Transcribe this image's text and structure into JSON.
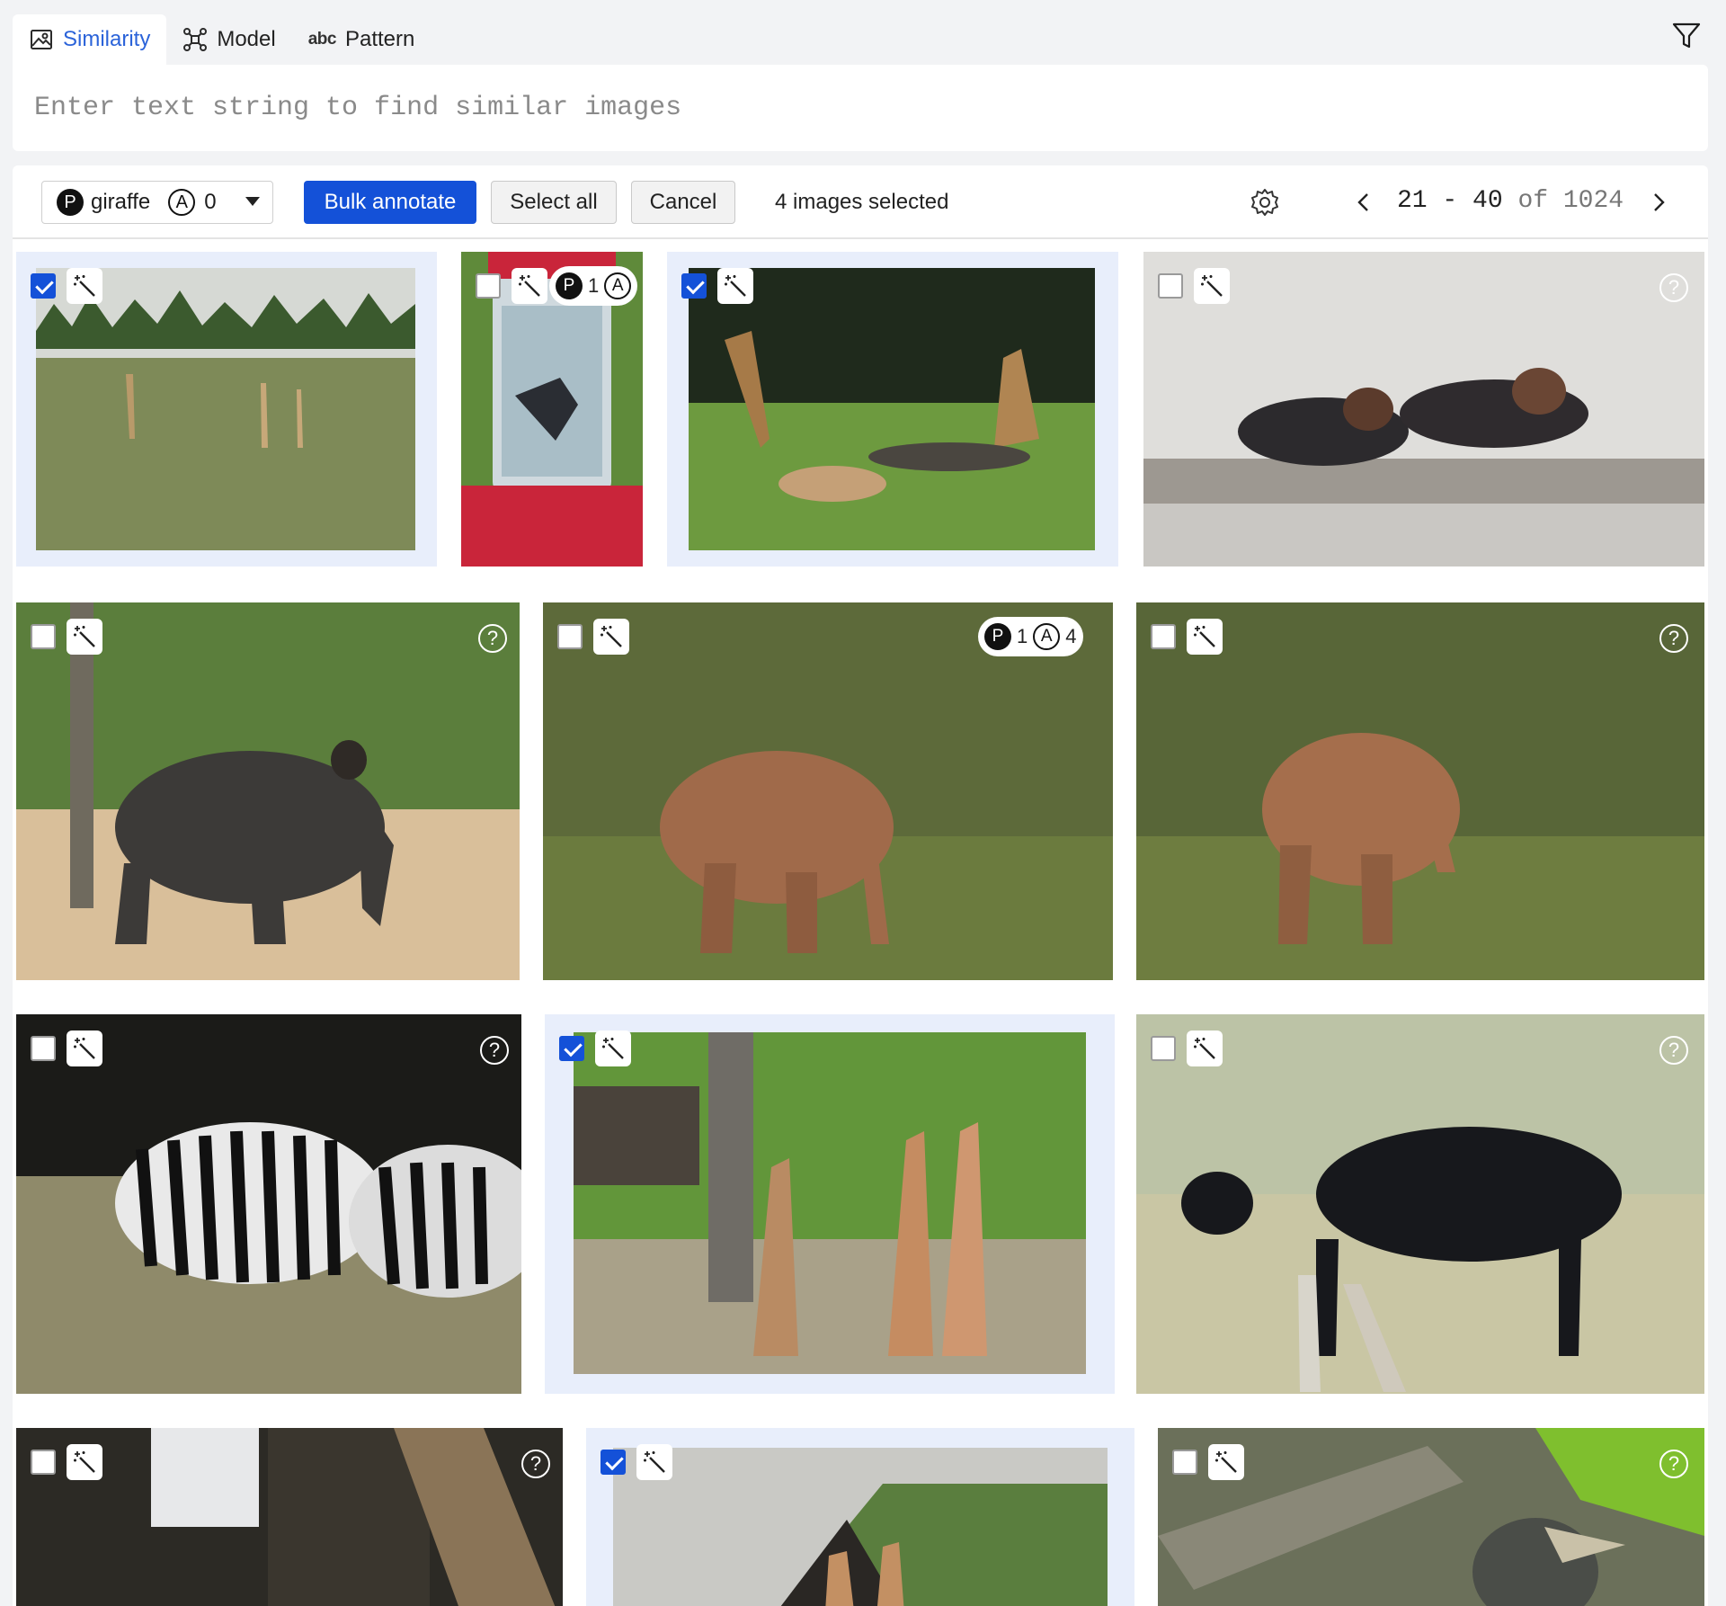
{
  "tabs": [
    {
      "label": "Similarity",
      "icon": "image-icon",
      "active": true
    },
    {
      "label": "Model",
      "icon": "network-icon",
      "active": false
    },
    {
      "label": "Pattern",
      "icon": "abc-icon",
      "icon_text": "abc",
      "active": false
    }
  ],
  "search": {
    "placeholder": "Enter text string to find similar images",
    "value": ""
  },
  "toolbar": {
    "label_filter": {
      "p_badge": "P",
      "label": "giraffe",
      "a_badge": "A",
      "count": "0"
    },
    "bulk_annotate": "Bulk annotate",
    "select_all": "Select all",
    "cancel": "Cancel",
    "selected_text": "4 images selected"
  },
  "pagination": {
    "range_start": "21",
    "sep": " - ",
    "range_end": "40",
    "of": " of ",
    "total": "1024"
  },
  "colors": {
    "accent": "#1451d8",
    "active_tab_text": "#2b63d9",
    "selected_card_bg": "#e8eefb"
  },
  "cards": [
    {
      "subject": "giraffes in field",
      "checked": true
    },
    {
      "subject": "bird at hummingbird feeder",
      "checked": false,
      "pa": {
        "p": "P",
        "p_count": "1",
        "a": "A"
      }
    },
    {
      "subject": "giraffes resting on grass",
      "checked": true
    },
    {
      "subject": "two swallows on ledge",
      "checked": false,
      "help": "?"
    },
    {
      "subject": "elephant with rider",
      "checked": false,
      "help": "?"
    },
    {
      "subject": "elephant on hillside",
      "checked": false,
      "pa": {
        "p": "P",
        "p_count": "1",
        "a": "A",
        "a_count": "4"
      }
    },
    {
      "subject": "elephant grazing",
      "checked": false,
      "help": "?"
    },
    {
      "subject": "zebras",
      "checked": false,
      "help": "?"
    },
    {
      "subject": "giraffes by trees",
      "checked": true
    },
    {
      "subject": "black cow at fence",
      "checked": false,
      "help": "?"
    },
    {
      "subject": "giraffe indoors",
      "checked": false,
      "help": "?"
    },
    {
      "subject": "giraffes by barn",
      "checked": true
    },
    {
      "subject": "hornbill in foliage",
      "checked": false,
      "help": "?"
    }
  ]
}
